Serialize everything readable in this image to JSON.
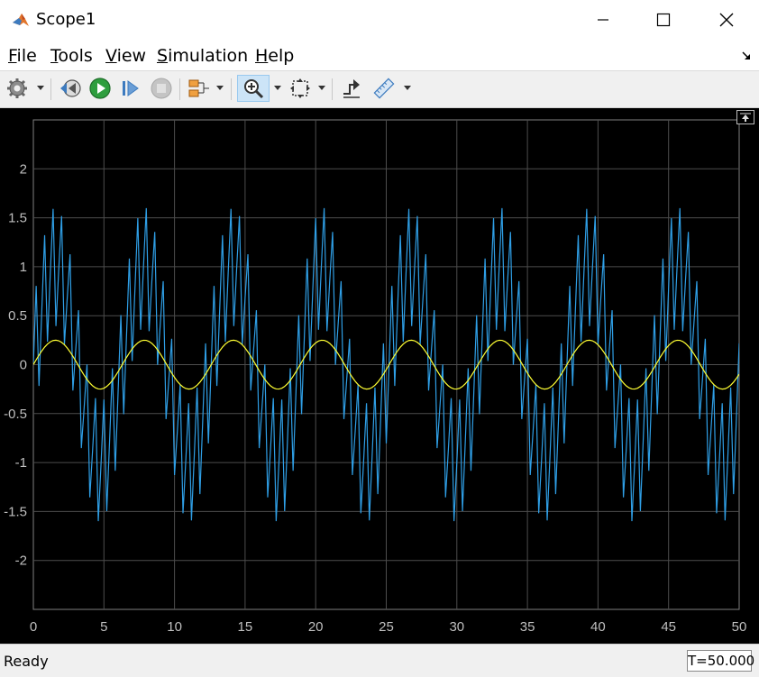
{
  "window": {
    "title": "Scope1",
    "icon": "matlab-logo-icon",
    "controls": [
      "minimize-icon",
      "maximize-icon",
      "close-icon"
    ]
  },
  "menu": {
    "items": [
      {
        "label": "File",
        "mnemonic": "F",
        "rest": "ile"
      },
      {
        "label": "Tools",
        "mnemonic": "T",
        "rest": "ools"
      },
      {
        "label": "View",
        "mnemonic": "V",
        "rest": "iew"
      },
      {
        "label": "Simulation",
        "mnemonic": "S",
        "rest": "imulation"
      },
      {
        "label": "Help",
        "mnemonic": "H",
        "rest": "elp"
      }
    ]
  },
  "toolbar": {
    "buttons": [
      "settings-icon",
      "step-back-icon",
      "run-icon",
      "step-forward-icon",
      "stop-icon",
      "highlight-simulink-icon",
      "zoom-in-icon",
      "fit-to-view-icon",
      "triggers-icon",
      "cursor-measurements-icon"
    ],
    "active": "zoom-in-icon"
  },
  "status": {
    "text": "Ready",
    "time": "T=50.000"
  },
  "colors": {
    "background": "#000000",
    "grid": "#4d4d4d",
    "axis_text": "#bfbfbf",
    "series1": "#2f9fe6",
    "series2": "#ffff33"
  },
  "chart_data": {
    "type": "line",
    "title": "",
    "xlabel": "",
    "ylabel": "",
    "xlim": [
      0,
      50
    ],
    "ylim": [
      -2.5,
      2.5
    ],
    "xticks": [
      0,
      5,
      10,
      15,
      20,
      25,
      30,
      35,
      40,
      45,
      50
    ],
    "yticks": [
      2,
      1.5,
      1,
      0.5,
      0,
      -0.5,
      -1,
      -1.5,
      -2
    ],
    "grid": true,
    "series": [
      {
        "color": "#2f9fe6",
        "sample_step": 0.2,
        "components": [
          {
            "amplitude": 1.0,
            "period": 6.3
          },
          {
            "amplitude": 0.7,
            "period": 0.6
          }
        ]
      },
      {
        "color": "#ffff33",
        "sample_step": 0.2,
        "components": [
          {
            "amplitude": 0.25,
            "period": 6.3
          }
        ]
      }
    ]
  }
}
